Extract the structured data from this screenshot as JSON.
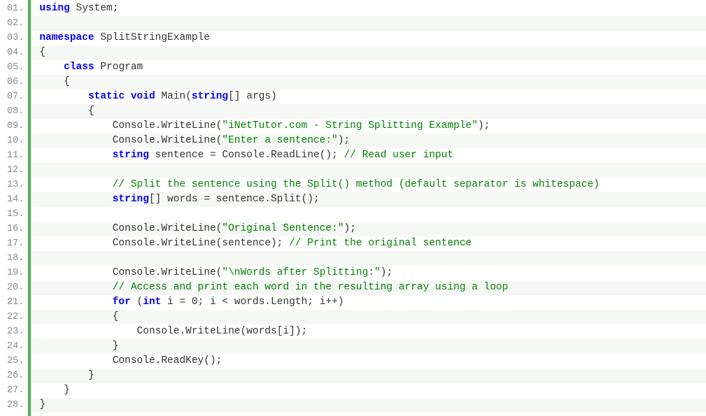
{
  "code": {
    "lineNumbers": [
      "01.",
      "02.",
      "03.",
      "04.",
      "05.",
      "06.",
      "07.",
      "08.",
      "09.",
      "10.",
      "11.",
      "12.",
      "13.",
      "14.",
      "15.",
      "16.",
      "17.",
      "18.",
      "19.",
      "20.",
      "21.",
      "22.",
      "23.",
      "24.",
      "25.",
      "26.",
      "27.",
      "28."
    ],
    "t": {
      "using": "using",
      "system": "System;",
      "namespace": "namespace",
      "nsName": "SplitStringExample",
      "ob": "{",
      "cb": "}",
      "class": "class",
      "program": "Program",
      "static": "static",
      "void": "void",
      "main": "Main(",
      "string": "string",
      "arrArgs": "[] args)",
      "cw": "Console.WriteLine(",
      "s1": "\"iNetTutor.com - String Splitting Example\"",
      "rp": ");",
      "s2": "\"Enter a sentence:\"",
      "sentenceDecl": " sentence = Console.ReadLine(); ",
      "c1": "// Read user input",
      "c2": "// Split the sentence using the Split() method (default separator is whitespace)",
      "wordsDecl": "[] words = sentence.Split();",
      "s3": "\"Original Sentence:\"",
      "cwSent": "Console.WriteLine(sentence); ",
      "c3": "// Print the original sentence",
      "s4": "\"\\nWords after Splitting:\"",
      "c4": "// Access and print each word in the resulting array using a loop",
      "for": "for",
      "forHead1": " (",
      "int": "int",
      "forHead2": " i = 0; i < words.Length; i++)",
      "cwWord": "Console.WriteLine(words[i]);",
      "rk": "Console.ReadKey();"
    }
  }
}
